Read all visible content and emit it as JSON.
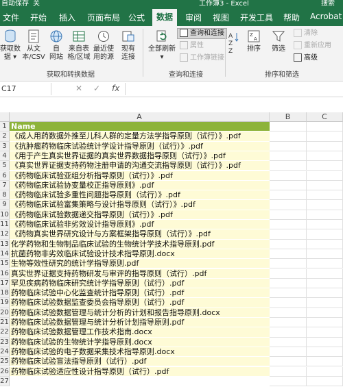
{
  "title_bar": {
    "left_text": "自动保存",
    "toggle": "关",
    "doc_title": "工作簿3 - Excel",
    "search": "搜索"
  },
  "ribbon_tabs": [
    {
      "label": "文件"
    },
    {
      "label": "开始"
    },
    {
      "label": "插入"
    },
    {
      "label": "页面布局"
    },
    {
      "label": "公式"
    },
    {
      "label": "数据",
      "active": true
    },
    {
      "label": "审阅"
    },
    {
      "label": "视图"
    },
    {
      "label": "开发工具"
    },
    {
      "label": "帮助"
    },
    {
      "label": "Acrobat"
    }
  ],
  "ribbon": {
    "get_data": {
      "line1": "获取数",
      "line2": "据 ▾"
    },
    "from_csv": {
      "line1": "从文",
      "line2": "本/CSV"
    },
    "from_web": {
      "line1": "自",
      "line2": "网站"
    },
    "from_table": {
      "line1": "来自表",
      "line2": "格/区域"
    },
    "recent": {
      "line1": "最近使",
      "line2": "用的源"
    },
    "existing": {
      "line1": "现有",
      "line2": "连接"
    },
    "group1": "获取和转换数据",
    "refresh_all": {
      "line1": "全部刷新",
      "line2": "▾"
    },
    "queries": "查询和连接",
    "properties": "属性",
    "edit_links": "工作簿链接",
    "group2": "查询和连接",
    "sort": "排序",
    "filter": "筛选",
    "clear": "清除",
    "reapply": "重新应用",
    "advanced": "高级",
    "group3": "排序和筛选"
  },
  "formula_bar": {
    "name_box": "C17",
    "cancel": "✕",
    "enter": "✓",
    "fx": "fx",
    "formula": ""
  },
  "columns": [
    "A",
    "B",
    "C"
  ],
  "header_cell": "Name",
  "rows": [
    {
      "n": "1",
      "text": "Name"
    },
    {
      "n": "2",
      "text": "《成人用药数据外推至儿科人群的定量方法学指导原则（试行）》.pdf"
    },
    {
      "n": "3",
      "text": "《抗肿瘤药物临床试验统计学设计指导原则（试行）》.pdf"
    },
    {
      "n": "4",
      "text": "《用于产生真实世界证据的真实世界数据指导原则（试行）》.pdf"
    },
    {
      "n": "5",
      "text": "《真实世界证据支持药物注册申请的沟通交流指导原则（试行）》.pdf"
    },
    {
      "n": "6",
      "text": "《药物临床试验亚组分析指导原则（试行）》.pdf"
    },
    {
      "n": "7",
      "text": "《药物临床试验协变量校正指导原则》.pdf"
    },
    {
      "n": "8",
      "text": "《药物临床试验多重性问题指导原则（试行）》.pdf"
    },
    {
      "n": "9",
      "text": "《药物临床试验富集策略与设计指导原则（试行）》.pdf"
    },
    {
      "n": "10",
      "text": "《药物临床试验数据递交指导原则（试行）》.pdf"
    },
    {
      "n": "11",
      "text": "《药物临床试验非劣效设计指导原则》.pdf"
    },
    {
      "n": "12",
      "text": "《药物真实世界研究设计与方案框架指导原则（试行）》.pdf"
    },
    {
      "n": "13",
      "text": "化学药物和生物制品临床试验的生物统计学技术指导原则.pdf"
    },
    {
      "n": "14",
      "text": "抗菌药物非劣效临床试验设计技术指导原则.docx"
    },
    {
      "n": "15",
      "text": "生物等效性研究的统计学指导原则.pdf"
    },
    {
      "n": "16",
      "text": "真实世界证据支持药物研发与审评的指导原则（试行）.pdf"
    },
    {
      "n": "17",
      "text": "罕见疾病药物临床研究统计学指导原则（试行）.pdf"
    },
    {
      "n": "18",
      "text": "药物临床试验中心化监查统计指导原则（试行）.pdf"
    },
    {
      "n": "19",
      "text": "药物临床试验数据监查委员会指导原则（试行）.pdf"
    },
    {
      "n": "20",
      "text": "药物临床试验数据管理与统计分析的计划和报告指导原则.docx"
    },
    {
      "n": "21",
      "text": "药物临床试验数据管理与统计分析计划指导原则.pdf"
    },
    {
      "n": "22",
      "text": "药物临床试验数据管理工作技术指南.docx"
    },
    {
      "n": "23",
      "text": "药物临床试验的生物统计学指导原则.docx"
    },
    {
      "n": "24",
      "text": "药物临床试验的电子数据采集技术指导原则.docx"
    },
    {
      "n": "25",
      "text": "药物临床试验盲法指导原则（试行）.pdf"
    },
    {
      "n": "26",
      "text": "药物临床试验适应性设计指导原则（试行）.pdf"
    },
    {
      "n": "27",
      "text": ""
    }
  ],
  "colors": {
    "excel_green": "#217346",
    "header_fill": "#8db33a",
    "row_fill": "#fefbd6"
  }
}
